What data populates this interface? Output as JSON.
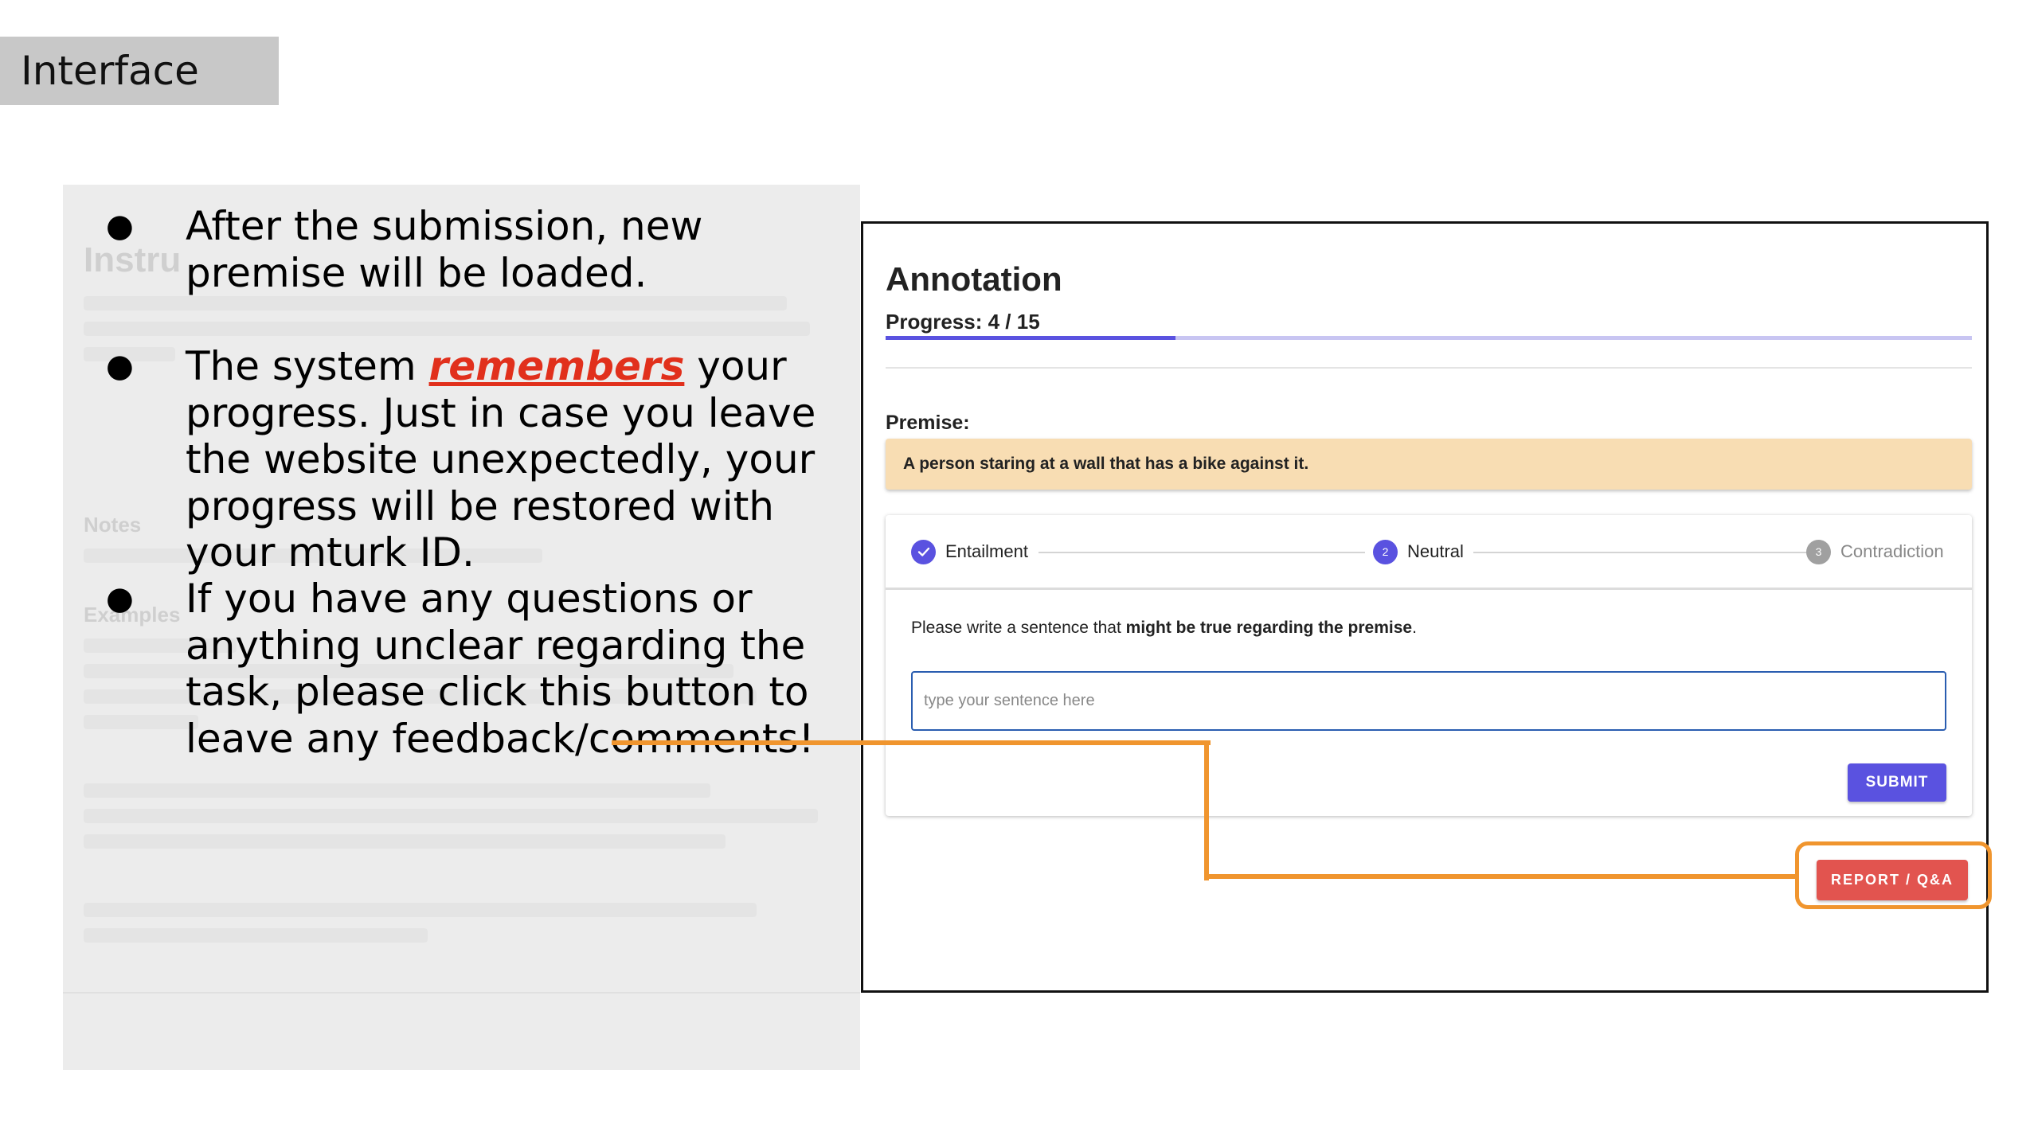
{
  "slide": {
    "tag": "Interface"
  },
  "bullets": [
    {
      "text": "After the submission, new premise will be loaded."
    },
    {
      "pre": "The system ",
      "highlight": "remembers",
      "post": " your progress. Just in case you leave the website unexpectedly, your progress will be restored with your mturk ID."
    },
    {
      "text": "If you have any questions or anything unclear regarding the task, please click this button to leave any feedback/comments!"
    }
  ],
  "background_panel": {
    "title": "Instru",
    "notes_heading": "Notes",
    "examples_heading": "Examples"
  },
  "annotation": {
    "title": "Annotation",
    "progress_label": "Progress: 4 / 15",
    "progress": {
      "current": 4,
      "total": 15
    },
    "premise_label": "Premise:",
    "premise_text": "A person staring at a wall that has a bike against it.",
    "steps": [
      {
        "label": "Entailment",
        "state": "done"
      },
      {
        "number": "2",
        "label": "Neutral",
        "state": "active"
      },
      {
        "number": "3",
        "label": "Contradiction",
        "state": "pending"
      }
    ],
    "instruction_pre": "Please write a sentence that ",
    "instruction_bold": "might be true regarding the premise",
    "instruction_post": ".",
    "input_placeholder": "type your sentence here",
    "input_value": "",
    "submit_label": "SUBMIT",
    "report_label": "REPORT / Q&A"
  },
  "colors": {
    "accent": "#5a52e0",
    "premise_bg": "#f8ddb3",
    "report_button": "#e2544f",
    "callout": "#f0952e",
    "highlight": "#e1301c"
  }
}
